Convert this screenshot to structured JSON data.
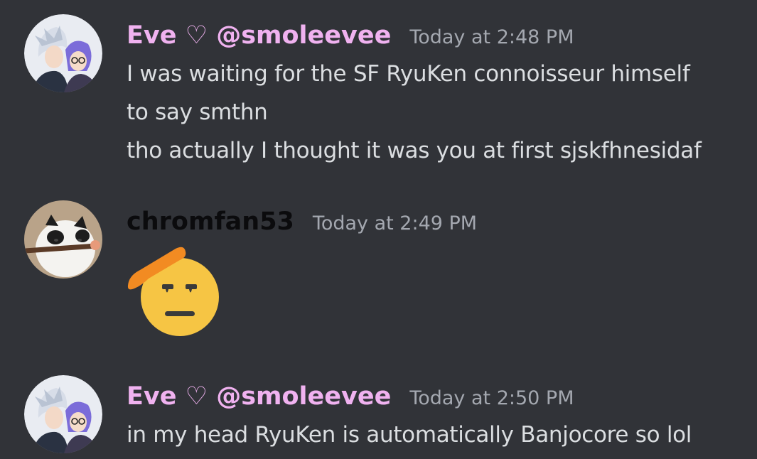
{
  "messages": [
    {
      "author": "Eve ♡ @smoleevee",
      "author_color": "#f0b2f0",
      "timestamp": "Today at 2:48 PM",
      "lines": [
        "I was waiting for the SF RyuKen connoisseur himself",
        "to say smthn",
        "tho actually I thought it was you at first sjskfhnesidaf"
      ],
      "avatar_icon": "anime-couple-avatar"
    },
    {
      "author": "chromfan53",
      "author_color": "#0b0b0d",
      "timestamp": "Today at 2:49 PM",
      "emoji": "saluting-face-emoji",
      "avatar_icon": "cat-with-stick-avatar"
    },
    {
      "author": "Eve ♡ @smoleevee",
      "author_color": "#f0b2f0",
      "timestamp": "Today at 2:50 PM",
      "lines": [
        "in my head RyuKen is automatically Banjocore so lol"
      ],
      "avatar_icon": "anime-couple-avatar"
    }
  ],
  "colors": {
    "background": "#313338",
    "text": "#dbdee1",
    "timestamp": "#a4a8b0"
  }
}
